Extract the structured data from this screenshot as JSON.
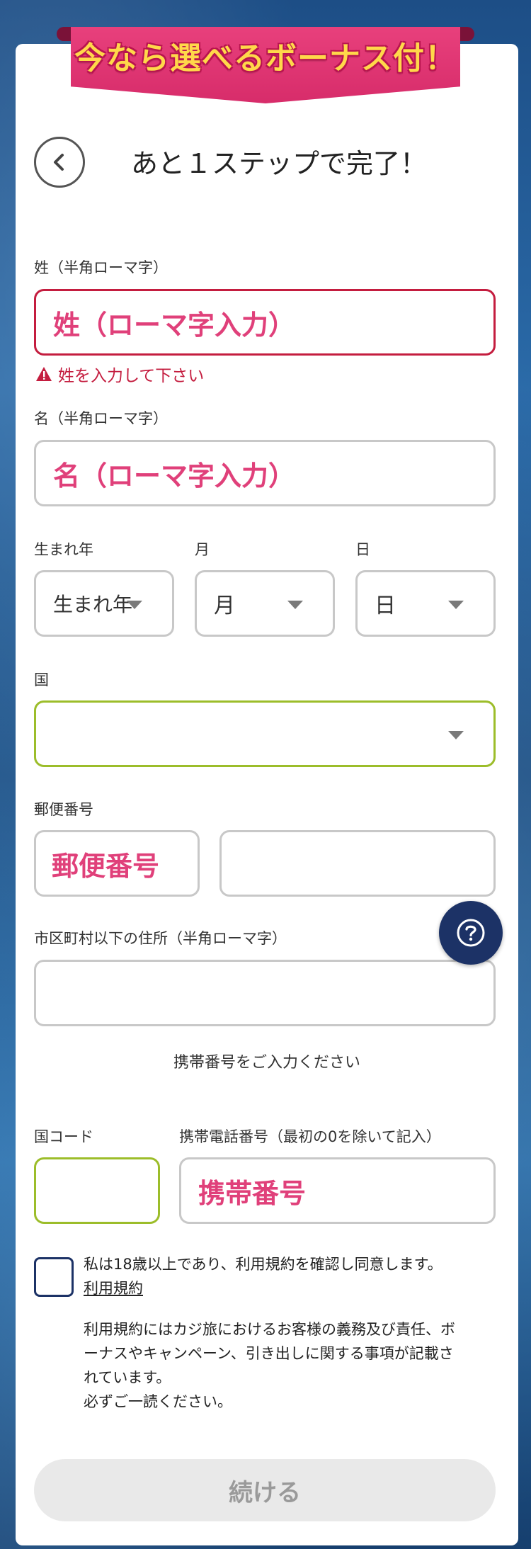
{
  "banner": {
    "text": "今なら選べるボーナス付！"
  },
  "header": {
    "title": "あと１ステップで完了！"
  },
  "form": {
    "last_name": {
      "label": "姓（半角ローマ字）",
      "placeholder": "姓（ローマ字入力）",
      "error": "姓を入力して下さい"
    },
    "first_name": {
      "label": "名（半角ローマ字）",
      "placeholder": "名（ローマ字入力）"
    },
    "birth_year": {
      "label": "生まれ年",
      "value": "生まれ年"
    },
    "birth_month": {
      "label": "月",
      "value": "月"
    },
    "birth_day": {
      "label": "日",
      "value": "日"
    },
    "country": {
      "label": "国",
      "value": ""
    },
    "postal_code": {
      "label": "郵便番号",
      "placeholder": "郵便番号",
      "value2": ""
    },
    "address": {
      "label": "市区町村以下の住所（半角ローマ字）",
      "value": ""
    },
    "phone_prompt": "携帯番号をご入力ください",
    "country_code": {
      "label": "国コード",
      "value": ""
    },
    "mobile": {
      "label": "携帯電話番号（最初の0を除いて記入）",
      "placeholder": "携帯番号"
    },
    "consent": {
      "text": "私は18歳以上であり、利用規約を確認し同意します。",
      "link": "利用規約",
      "description_lines": [
        "利用規約にはカジ旅におけるお客様の義務及び責任、ボ",
        "ーナスやキャンペーン、引き出しに関する事項が記載さ",
        "れています。",
        "必ずご一読ください。"
      ]
    }
  },
  "buttons": {
    "continue": "続ける"
  },
  "colors": {
    "error": "#c41d3f",
    "accent_pink": "#e0407a",
    "green_border": "#9cbd2a",
    "navy": "#1c3266"
  },
  "icons": {
    "back": "chevron-left-icon",
    "error": "warning-icon",
    "help": "question-mark-icon",
    "dropdown": "caret-down-icon"
  }
}
